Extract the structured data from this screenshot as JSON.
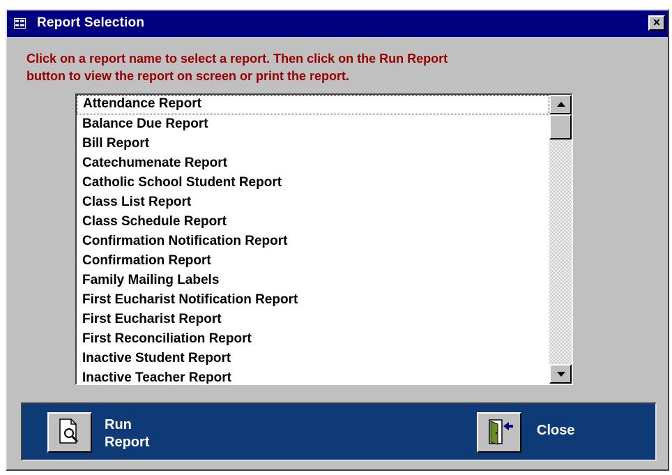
{
  "window": {
    "title": "Report Selection",
    "close_glyph": "×"
  },
  "instructions": {
    "line1": "Click on a report name to select a report.  Then click on the Run Report",
    "line2": "button to  view the report on screen or print the report."
  },
  "reports": [
    "Attendance Report",
    "Balance Due Report",
    "Bill Report",
    "Catechumenate Report",
    "Catholic School Student Report",
    "Class List Report",
    "Class Schedule Report",
    "Confirmation Notification Report",
    "Confirmation Report",
    "Family Mailing Labels",
    "First Eucharist Notification Report",
    "First Eucharist Report",
    "First Reconciliation Report",
    "Inactive Student Report",
    "Inactive Teacher Report"
  ],
  "buttons": {
    "run_report_line1": "Run",
    "run_report_line2": "Report",
    "close_label": "Close"
  },
  "icons": {
    "title": "form-icon",
    "run_report": "magnifier-document-icon",
    "close": "exit-door-icon",
    "scroll_up": "arrow-up-icon",
    "scroll_down": "arrow-down-icon"
  },
  "colors": {
    "titlebar": "#000080",
    "instruction_text": "#990000",
    "footer": "#0f3a78",
    "face": "#c0c0c0"
  }
}
